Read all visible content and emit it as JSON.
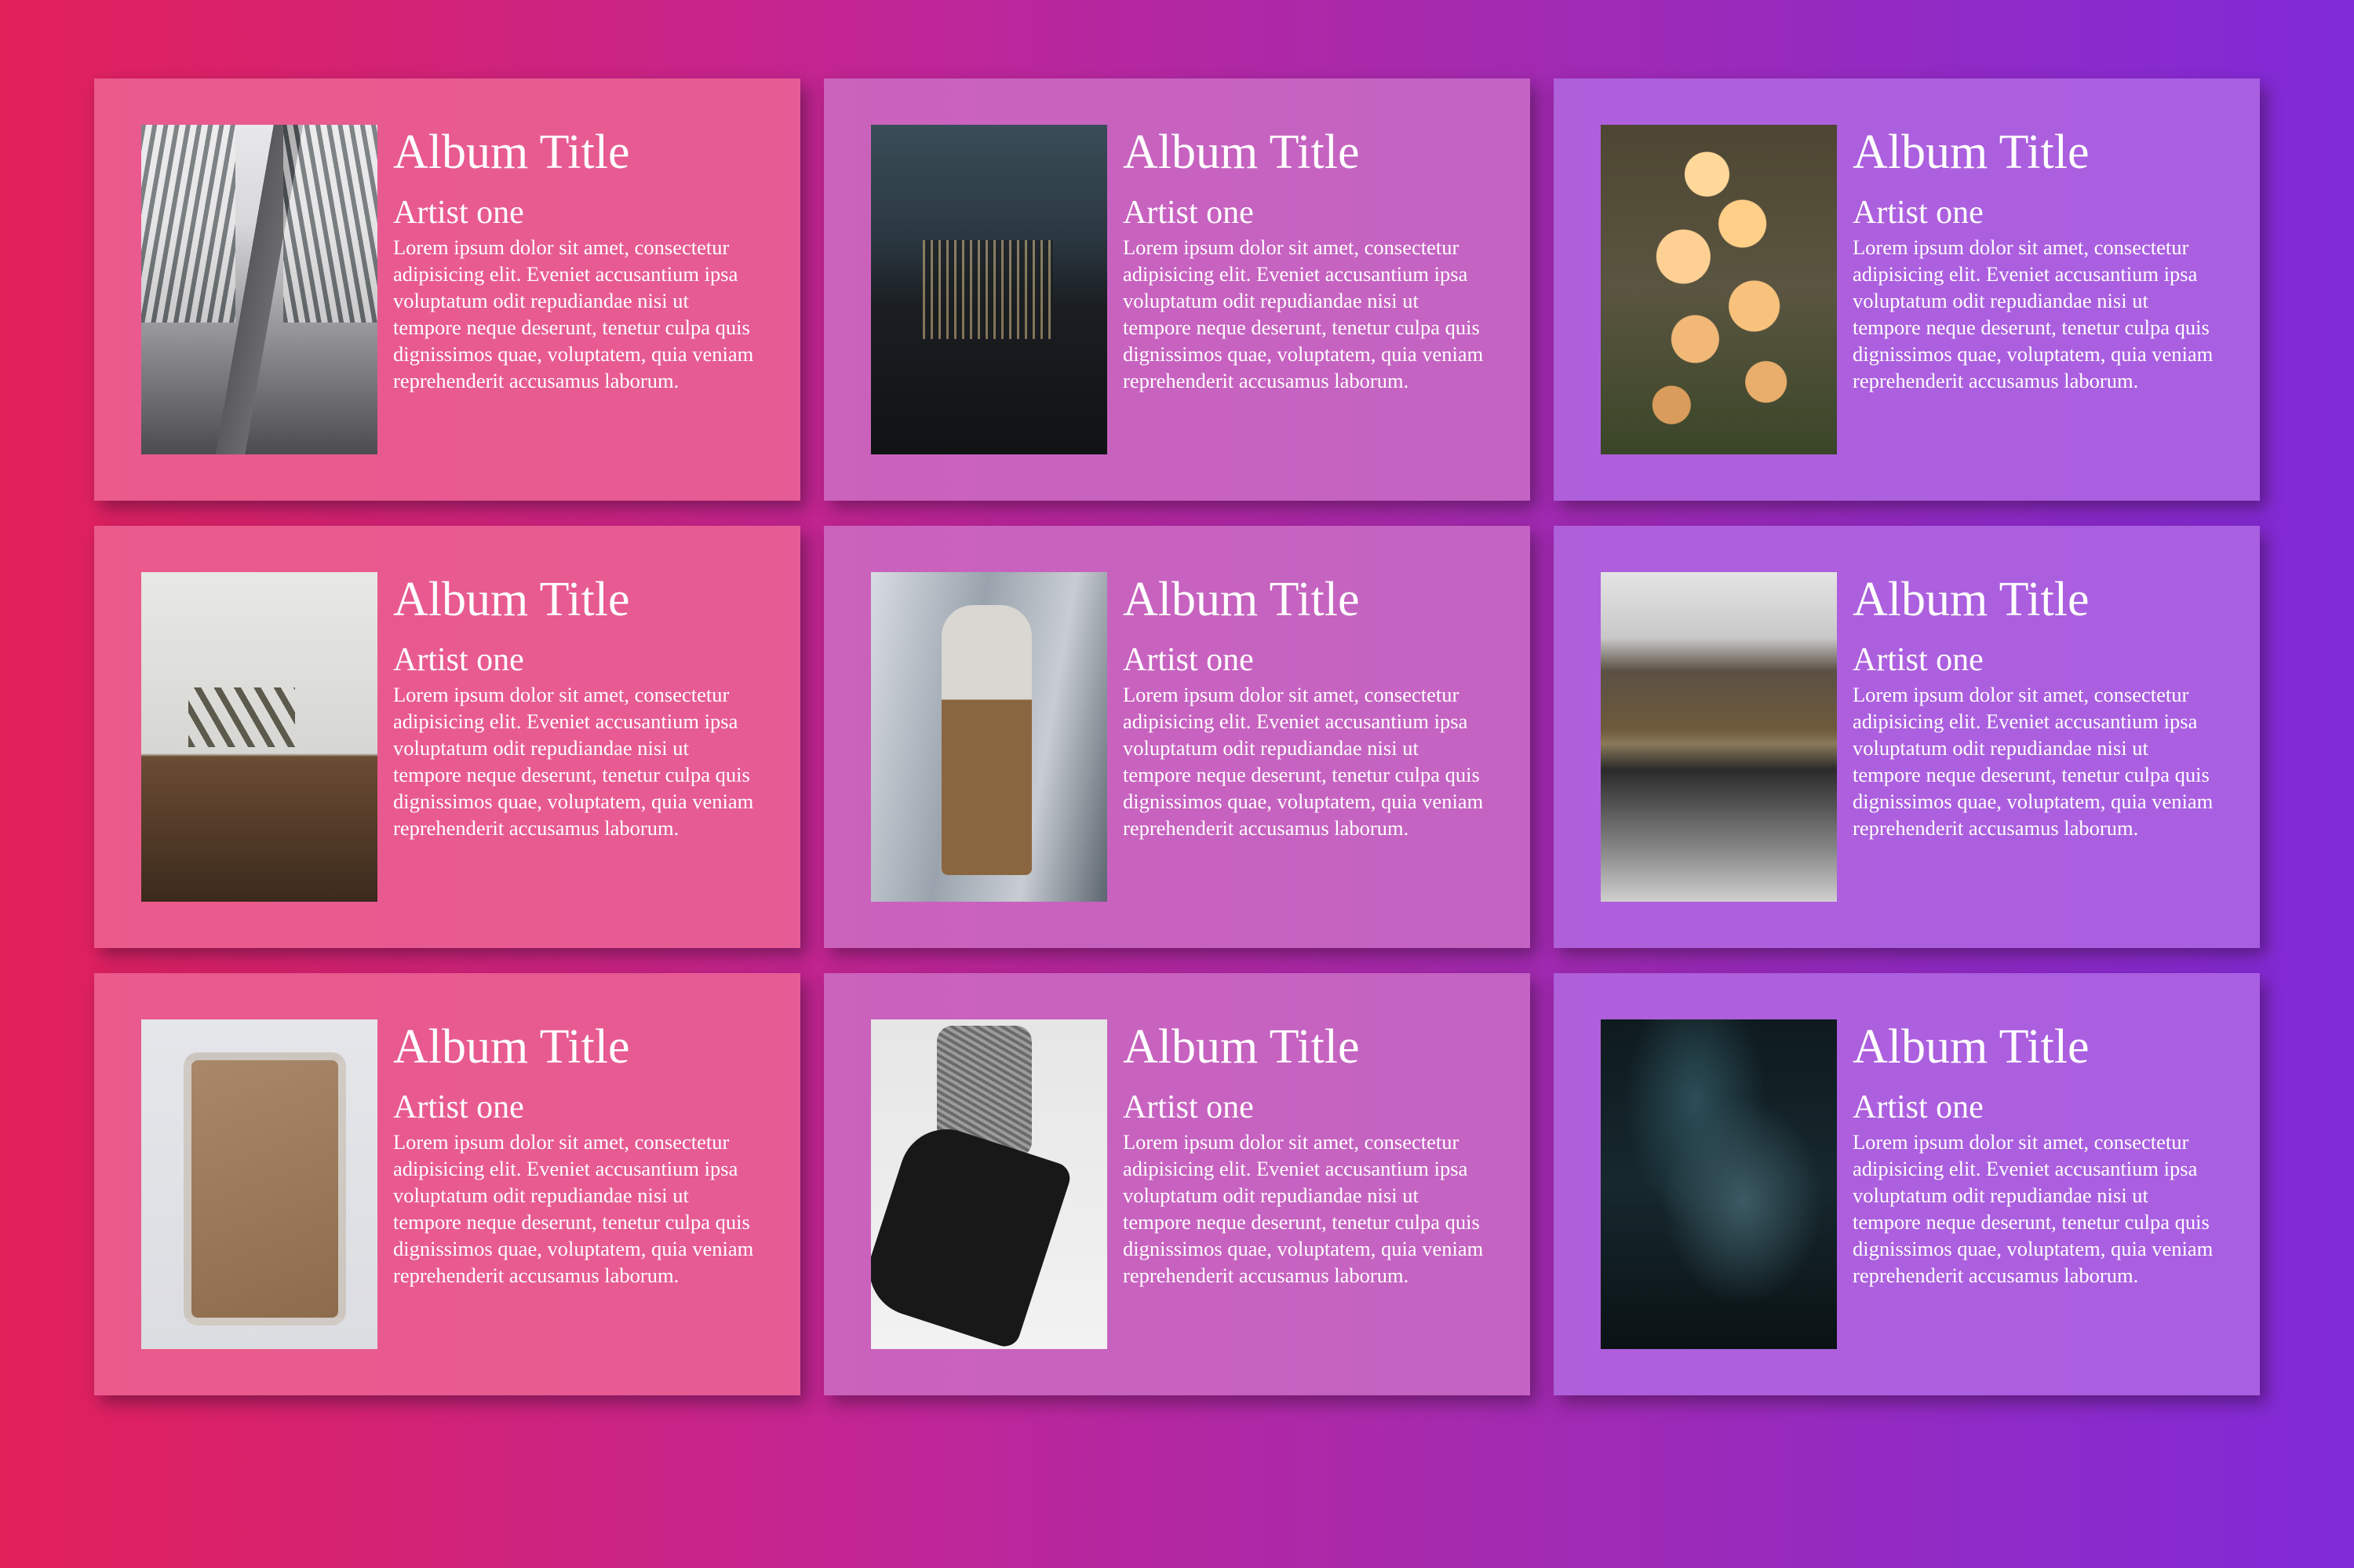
{
  "cards": [
    {
      "title": "Album Title",
      "artist": "Artist one",
      "description": "Lorem ipsum dolor sit amet, consectetur adipisicing elit. Eveniet accusantium ipsa voluptatum odit repudiandae nisi ut tempore neque deserunt, tenetur culpa quis dignissimos quae, voluptatem, quia veniam reprehenderit accusamus laborum.",
      "image": "snowy-road-photo"
    },
    {
      "title": "Album Title",
      "artist": "Artist one",
      "description": "Lorem ipsum dolor sit amet, consectetur adipisicing elit. Eveniet accusantium ipsa voluptatum odit repudiandae nisi ut tempore neque deserunt, tenetur culpa quis dignissimos quae, voluptatem, quia veniam reprehenderit accusamus laborum.",
      "image": "city-night-photo"
    },
    {
      "title": "Album Title",
      "artist": "Artist one",
      "description": "Lorem ipsum dolor sit amet, consectetur adipisicing elit. Eveniet accusantium ipsa voluptatum odit repudiandae nisi ut tempore neque deserunt, tenetur culpa quis dignissimos quae, voluptatem, quia veniam reprehenderit accusamus laborum.",
      "image": "bokeh-lights-photo"
    },
    {
      "title": "Album Title",
      "artist": "Artist one",
      "description": "Lorem ipsum dolor sit amet, consectetur adipisicing elit. Eveniet accusantium ipsa voluptatum odit repudiandae nisi ut tempore neque deserunt, tenetur culpa quis dignissimos quae, voluptatem, quia veniam reprehenderit accusamus laborum.",
      "image": "still-life-photo"
    },
    {
      "title": "Album Title",
      "artist": "Artist one",
      "description": "Lorem ipsum dolor sit amet, consectetur adipisicing elit. Eveniet accusantium ipsa voluptatum odit repudiandae nisi ut tempore neque deserunt, tenetur culpa quis dignissimos quae, voluptatem, quia veniam reprehenderit accusamus laborum.",
      "image": "fashion-photo"
    },
    {
      "title": "Album Title",
      "artist": "Artist one",
      "description": "Lorem ipsum dolor sit amet, consectetur adipisicing elit. Eveniet accusantium ipsa voluptatum odit repudiandae nisi ut tempore neque deserunt, tenetur culpa quis dignissimos quae, voluptatem, quia veniam reprehenderit accusamus laborum.",
      "image": "lake-house-photo"
    },
    {
      "title": "Album Title",
      "artist": "Artist one",
      "description": "Lorem ipsum dolor sit amet, consectetur adipisicing elit. Eveniet accusantium ipsa voluptatum odit repudiandae nisi ut tempore neque deserunt, tenetur culpa quis dignissimos quae, voluptatem, quia veniam reprehenderit accusamus laborum.",
      "image": "ice-cream-photo"
    },
    {
      "title": "Album Title",
      "artist": "Artist one",
      "description": "Lorem ipsum dolor sit amet, consectetur adipisicing elit. Eveniet accusantium ipsa voluptatum odit repudiandae nisi ut tempore neque deserunt, tenetur culpa quis dignissimos quae, voluptatem, quia veniam reprehenderit accusamus laborum.",
      "image": "seated-person-photo"
    },
    {
      "title": "Album Title",
      "artist": "Artist one",
      "description": "Lorem ipsum dolor sit amet, consectetur adipisicing elit. Eveniet accusantium ipsa voluptatum odit repudiandae nisi ut tempore neque deserunt, tenetur culpa quis dignissimos quae, voluptatem, quia veniam reprehenderit accusamus laborum.",
      "image": "dark-water-photo"
    }
  ],
  "colors": {
    "background_start": "#e2205a",
    "background_end": "#802ad8",
    "text": "#ffffff"
  }
}
